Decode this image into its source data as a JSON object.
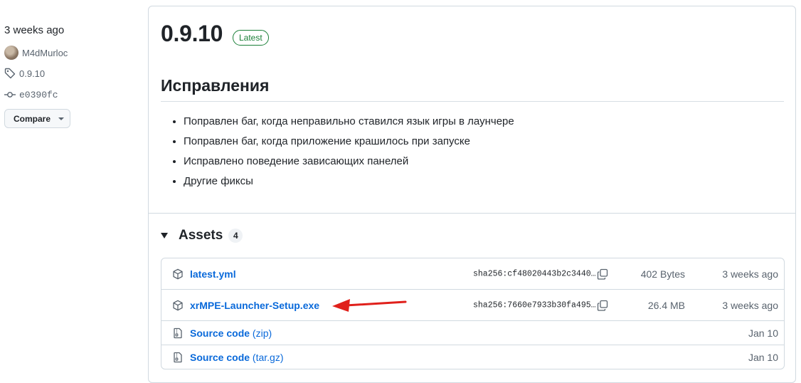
{
  "sidebar": {
    "date": "3 weeks ago",
    "author": "M4dMurloc",
    "tag": "0.9.10",
    "commit": "e0390fc",
    "compare_label": "Compare"
  },
  "release": {
    "version": "0.9.10",
    "badge": "Latest",
    "section_title": "Исправления",
    "notes": [
      "Поправлен баг, когда неправильно ставился язык игры в лаунчере",
      "Поправлен баг, когда приложение крашилось при запуске",
      "Исправлено поведение зависающих панелей",
      "Другие фиксы"
    ]
  },
  "assets": {
    "title": "Assets",
    "count": "4",
    "items": [
      {
        "name": "latest.yml",
        "sha": "sha256:cf48020443b2c3440…",
        "size": "402 Bytes",
        "date": "3 weeks ago",
        "icon": "package-icon"
      },
      {
        "name": "xrMPE-Launcher-Setup.exe",
        "sha": "sha256:7660e7933b30fa495…",
        "size": "26.4 MB",
        "date": "3 weeks ago",
        "icon": "package-icon"
      },
      {
        "name": "Source code",
        "ext": "(zip)",
        "date": "Jan 10",
        "icon": "file-zip-icon"
      },
      {
        "name": "Source code",
        "ext": "(tar.gz)",
        "date": "Jan 10",
        "icon": "file-zip-icon"
      }
    ]
  },
  "annotation": {
    "arrow_color": "#e0201b"
  },
  "colors": {
    "link": "#0969da",
    "badge": "#1a7f37",
    "border": "#d1d9e0",
    "muted": "#59636e"
  }
}
